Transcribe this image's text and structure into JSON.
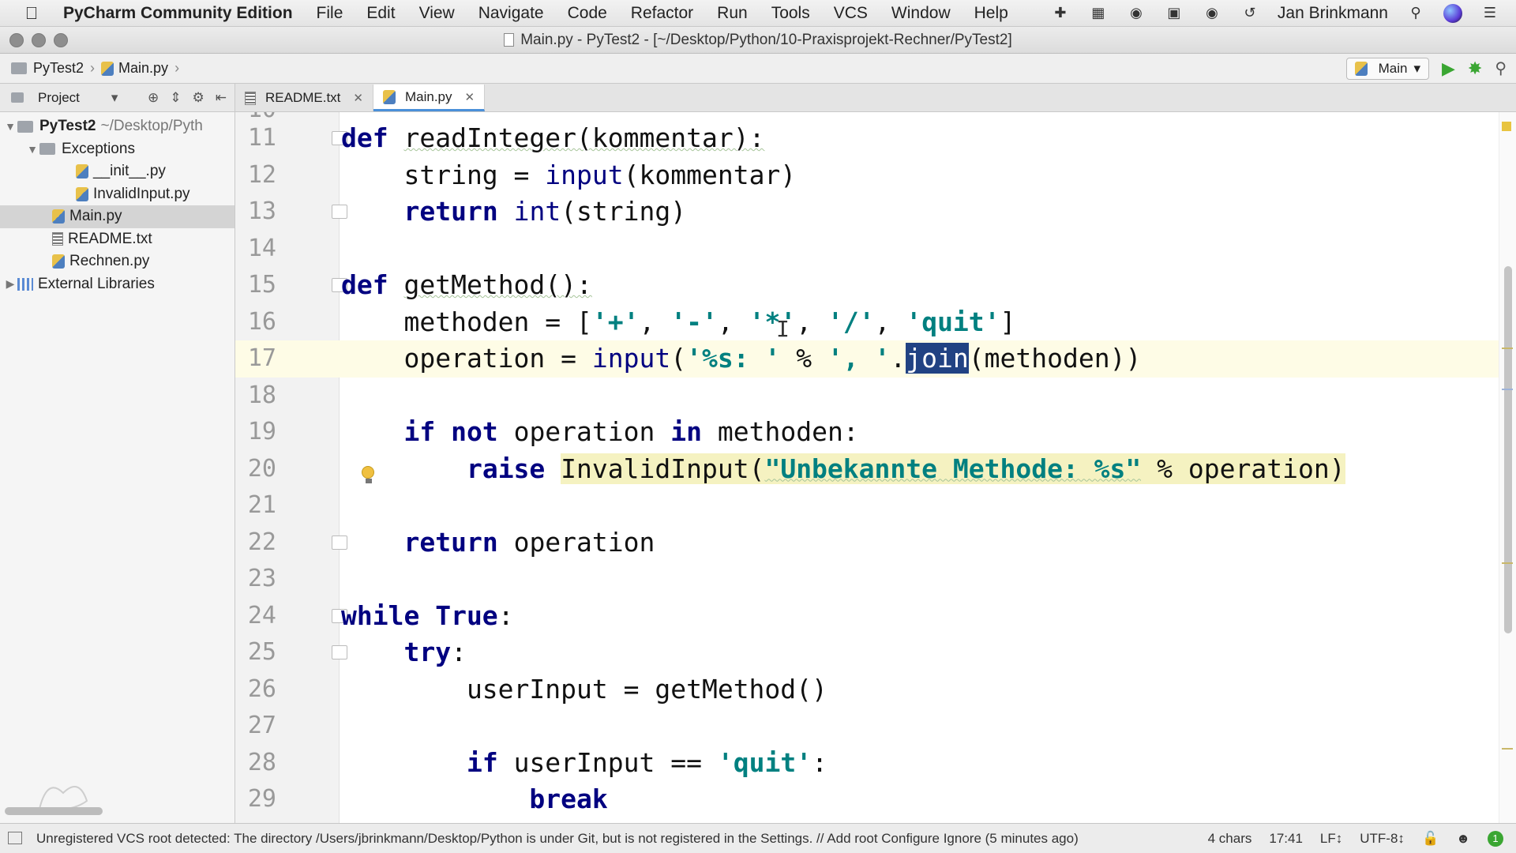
{
  "menubar": {
    "app_name": "PyCharm Community Edition",
    "items": [
      "File",
      "Edit",
      "View",
      "Navigate",
      "Code",
      "Refactor",
      "Run",
      "Tools",
      "VCS",
      "Window",
      "Help"
    ],
    "user": "Jan Brinkmann"
  },
  "window": {
    "title": "Main.py - PyTest2 - [~/Desktop/Python/10-Praxisprojekt-Rechner/PyTest2]"
  },
  "navbar": {
    "crumbs": [
      "PyTest2",
      "Main.py"
    ],
    "run_config": "Main"
  },
  "project_panel": {
    "label": "Project",
    "tree": [
      {
        "label": "PyTest2",
        "hint": "~/Desktop/Pyth",
        "icon": "folder-icon"
      },
      {
        "label": "Exceptions",
        "icon": "folder-icon"
      },
      {
        "label": "__init__.py",
        "icon": "python-file-icon"
      },
      {
        "label": "InvalidInput.py",
        "icon": "python-file-icon"
      },
      {
        "label": "Main.py",
        "icon": "python-file-icon"
      },
      {
        "label": "README.txt",
        "icon": "text-file-icon"
      },
      {
        "label": "Rechnen.py",
        "icon": "python-file-icon"
      },
      {
        "label": "External Libraries",
        "icon": "library-icon"
      }
    ]
  },
  "tabs": [
    {
      "label": "README.txt",
      "active": false
    },
    {
      "label": "Main.py",
      "active": true
    }
  ],
  "editor": {
    "top_partial_line": "10",
    "lines": [
      {
        "n": "11",
        "segs": [
          [
            "kw",
            "def"
          ],
          [
            "",
            " "
          ],
          [
            "wavy",
            "readInteger(kommentar):"
          ]
        ]
      },
      {
        "n": "12",
        "segs": [
          [
            "",
            "    string = "
          ],
          [
            "fn",
            "input"
          ],
          [
            "",
            "(kommentar)"
          ]
        ]
      },
      {
        "n": "13",
        "segs": [
          [
            "",
            "    "
          ],
          [
            "kw",
            "return"
          ],
          [
            "",
            " "
          ],
          [
            "fn",
            "int"
          ],
          [
            "",
            "(string)"
          ]
        ]
      },
      {
        "n": "14",
        "segs": []
      },
      {
        "n": "15",
        "segs": [
          [
            "kw",
            "def"
          ],
          [
            "",
            " "
          ],
          [
            "wavy",
            "getMethod():"
          ]
        ]
      },
      {
        "n": "16",
        "segs": [
          [
            "",
            "    methoden = ["
          ],
          [
            "str",
            "'+'"
          ],
          [
            "",
            ", "
          ],
          [
            "str",
            "'-'"
          ],
          [
            "",
            ", "
          ],
          [
            "str",
            "'*'"
          ],
          [
            "",
            ", "
          ],
          [
            "str",
            "'/'"
          ],
          [
            "",
            ", "
          ],
          [
            "str",
            "'quit'"
          ],
          [
            "",
            "]"
          ]
        ]
      },
      {
        "n": "17",
        "segs": [
          [
            "",
            "    operation = "
          ],
          [
            "fn",
            "input"
          ],
          [
            "",
            "("
          ],
          [
            "str",
            "'%s: '"
          ],
          [
            "",
            " % "
          ],
          [
            "str",
            "', '"
          ],
          [
            "",
            "."
          ],
          [
            "sel",
            "join"
          ],
          [
            "",
            "(methoden))"
          ]
        ]
      },
      {
        "n": "18",
        "segs": []
      },
      {
        "n": "19",
        "segs": [
          [
            "",
            "    "
          ],
          [
            "kw",
            "if not"
          ],
          [
            "",
            " operation "
          ],
          [
            "kw",
            "in"
          ],
          [
            "",
            " methoden:"
          ]
        ]
      },
      {
        "n": "20",
        "segs": [
          [
            "",
            "        "
          ],
          [
            "kw",
            "raise"
          ],
          [
            "",
            " "
          ],
          [
            "warn",
            "InvalidInput("
          ],
          [
            "warnstr",
            "\"Unbekannte Methode: %s\""
          ],
          [
            "warn",
            " % operation)"
          ]
        ]
      },
      {
        "n": "21",
        "segs": []
      },
      {
        "n": "22",
        "segs": [
          [
            "",
            "    "
          ],
          [
            "kw",
            "return"
          ],
          [
            "",
            " operation"
          ]
        ]
      },
      {
        "n": "23",
        "segs": []
      },
      {
        "n": "24",
        "segs": [
          [
            "kw",
            "while True"
          ],
          [
            "",
            ":"
          ]
        ]
      },
      {
        "n": "25",
        "segs": [
          [
            "",
            "    "
          ],
          [
            "kw",
            "try"
          ],
          [
            "",
            ":"
          ]
        ]
      },
      {
        "n": "26",
        "segs": [
          [
            "",
            "        userInput = getMethod()"
          ]
        ]
      },
      {
        "n": "27",
        "segs": []
      },
      {
        "n": "28",
        "segs": [
          [
            "",
            "        "
          ],
          [
            "kw",
            "if"
          ],
          [
            "",
            " userInput == "
          ],
          [
            "str",
            "'quit'"
          ],
          [
            "",
            ":"
          ]
        ]
      },
      {
        "n": "29",
        "segs": [
          [
            "",
            "            "
          ],
          [
            "kw",
            "break"
          ]
        ]
      }
    ],
    "current_line": "17"
  },
  "statusbar": {
    "message": "Unregistered VCS root detected: The directory /Users/jbrinkmann/Desktop/Python is under Git, but is not registered in the Settings. // Add root  Configure  Ignore (5 minutes ago)",
    "selection": "4 chars",
    "position": "17:41",
    "line_sep": "LF↕",
    "encoding": "UTF-8↕",
    "badge": "1"
  },
  "colors": {
    "keyword": "#000080",
    "string": "#008080",
    "selection": "#214283",
    "current_line": "#fefce6",
    "run_green": "#3aa632"
  }
}
